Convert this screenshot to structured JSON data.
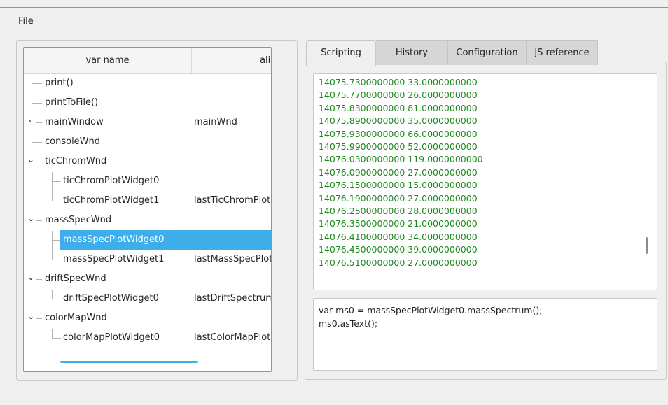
{
  "menubar": {
    "file_label": "File"
  },
  "tree": {
    "columns": {
      "var_name": "var name",
      "alias": "alias"
    },
    "rows": [
      {
        "name": "print()",
        "alias": ""
      },
      {
        "name": "printToFile()",
        "alias": ""
      },
      {
        "name": "mainWindow",
        "alias": "mainWnd"
      },
      {
        "name": "consoleWnd",
        "alias": ""
      },
      {
        "name": "ticChromWnd",
        "alias": ""
      },
      {
        "name": "ticChromPlotWidget0",
        "alias": ""
      },
      {
        "name": "ticChromPlotWidget1",
        "alias": "lastTicChromPlot"
      },
      {
        "name": "massSpecWnd",
        "alias": ""
      },
      {
        "name": "massSpecPlotWidget0",
        "alias": ""
      },
      {
        "name": "massSpecPlotWidget1",
        "alias": "lastMassSpecPlot"
      },
      {
        "name": "driftSpecWnd",
        "alias": ""
      },
      {
        "name": "driftSpecPlotWidget0",
        "alias": "lastDriftSpectrum"
      },
      {
        "name": "colorMapWnd",
        "alias": ""
      },
      {
        "name": "colorMapPlotWidget0",
        "alias": "lastColorMapPlot"
      }
    ]
  },
  "tabs": [
    "Scripting",
    "History",
    "Configuration",
    "JS reference"
  ],
  "output": {
    "color": "#1e8a1e",
    "lines": [
      "14075.7300000000 33.0000000000",
      "14075.7700000000 26.0000000000",
      "14075.8300000000 81.0000000000",
      "14075.8900000000 35.0000000000",
      "14075.9300000000 66.0000000000",
      "14075.9900000000 52.0000000000",
      "14076.0300000000 119.0000000000",
      "14076.0900000000 27.0000000000",
      "14076.1500000000 15.0000000000",
      "14076.1900000000 27.0000000000",
      "14076.2500000000 28.0000000000",
      "14076.3500000000 21.0000000000",
      "14076.4100000000 34.0000000000",
      "14076.4500000000 39.0000000000",
      "14076.5100000000 27.0000000000"
    ]
  },
  "editor": {
    "lines": [
      "var ms0 = massSpecPlotWidget0.massSpectrum();",
      "ms0.asText();"
    ]
  },
  "colors": {
    "accent": "#3daee9"
  }
}
